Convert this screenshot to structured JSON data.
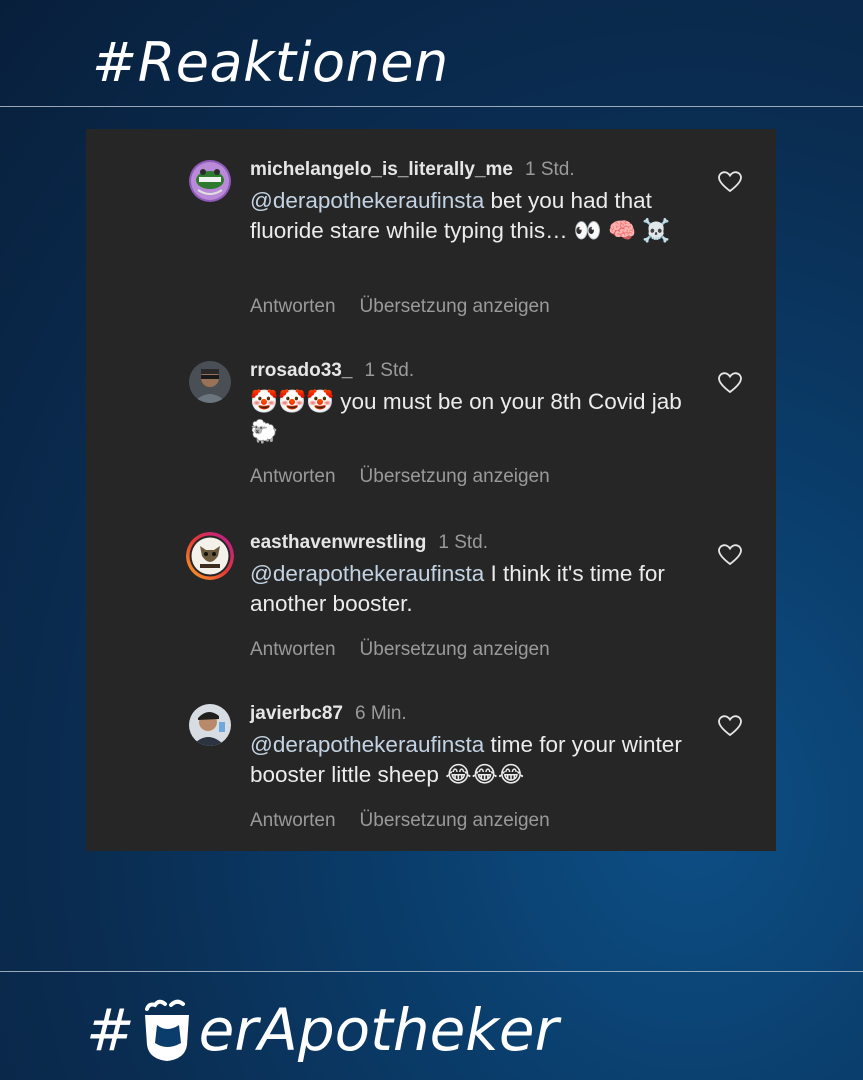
{
  "header": {
    "title": "#Reaktionen"
  },
  "footer": {
    "hash": "#",
    "brand_text": "erApotheker"
  },
  "comments": [
    {
      "username": "michelangelo_is_literally_me",
      "time": "1 Std.",
      "mention": "@derapothekeraufinsta",
      "text": " bet you had that fluoride stare while typing this… 👀 🧠 ☠️",
      "reply": "Antworten",
      "translate": "Übersetzung anzeigen"
    },
    {
      "username": "rrosado33_",
      "time": "1 Std.",
      "mention": "",
      "text": "🤡🤡🤡 you must be on your 8th Covid jab 🐑",
      "reply": "Antworten",
      "translate": "Übersetzung anzeigen"
    },
    {
      "username": "easthavenwrestling",
      "time": "1 Std.",
      "mention": "@derapothekeraufinsta",
      "text": " I think it's time for another booster.",
      "reply": "Antworten",
      "translate": "Übersetzung anzeigen"
    },
    {
      "username": "javierbc87",
      "time": "6 Min.",
      "mention": "@derapothekeraufinsta",
      "text": " time for your winter booster little sheep 😂😂😂",
      "reply": "Antworten",
      "translate": "Übersetzung anzeigen"
    }
  ],
  "colors": {
    "panel": "#262626",
    "mention": "#c4d3e3",
    "muted": "#9a9a9a",
    "background": "#0a2d52"
  }
}
